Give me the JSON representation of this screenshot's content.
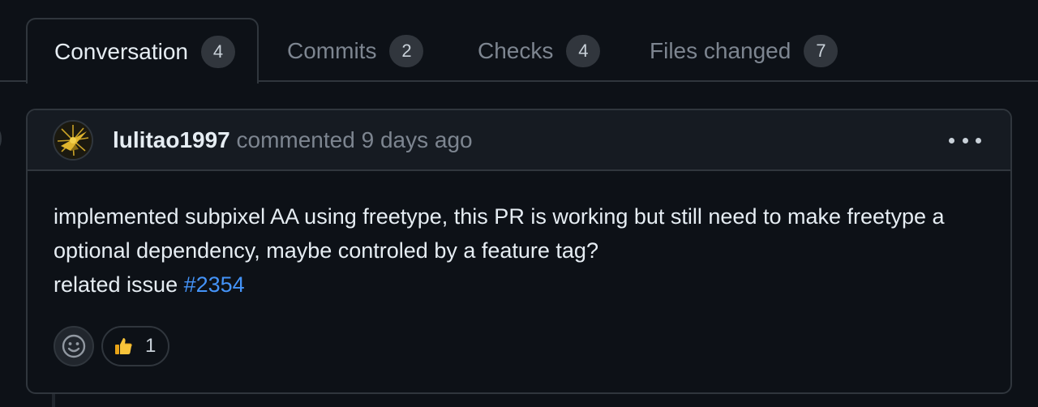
{
  "tabs": [
    {
      "label": "Conversation",
      "count": "4",
      "selected": true
    },
    {
      "label": "Commits",
      "count": "2",
      "selected": false
    },
    {
      "label": "Checks",
      "count": "4",
      "selected": false
    },
    {
      "label": "Files changed",
      "count": "7",
      "selected": false
    }
  ],
  "comment": {
    "author": "lulitao1997",
    "action": "commented",
    "time": "9 days ago",
    "body_line1": "implemented subpixel AA using freetype, this PR is working but still need to make freetype a optional dependency, maybe controled by a feature tag?",
    "body_line2_prefix": "related issue",
    "issue_link": "#2354"
  },
  "reactions": [
    {
      "emoji": "thumbs-up",
      "count": "1"
    }
  ],
  "colors": {
    "background": "#0d1117",
    "header_bg": "#161b22",
    "border": "#30363d",
    "link": "#4493f8",
    "muted_text": "#7d8590",
    "primary_text": "#e6edf3",
    "counter_bg": "#31363d"
  }
}
